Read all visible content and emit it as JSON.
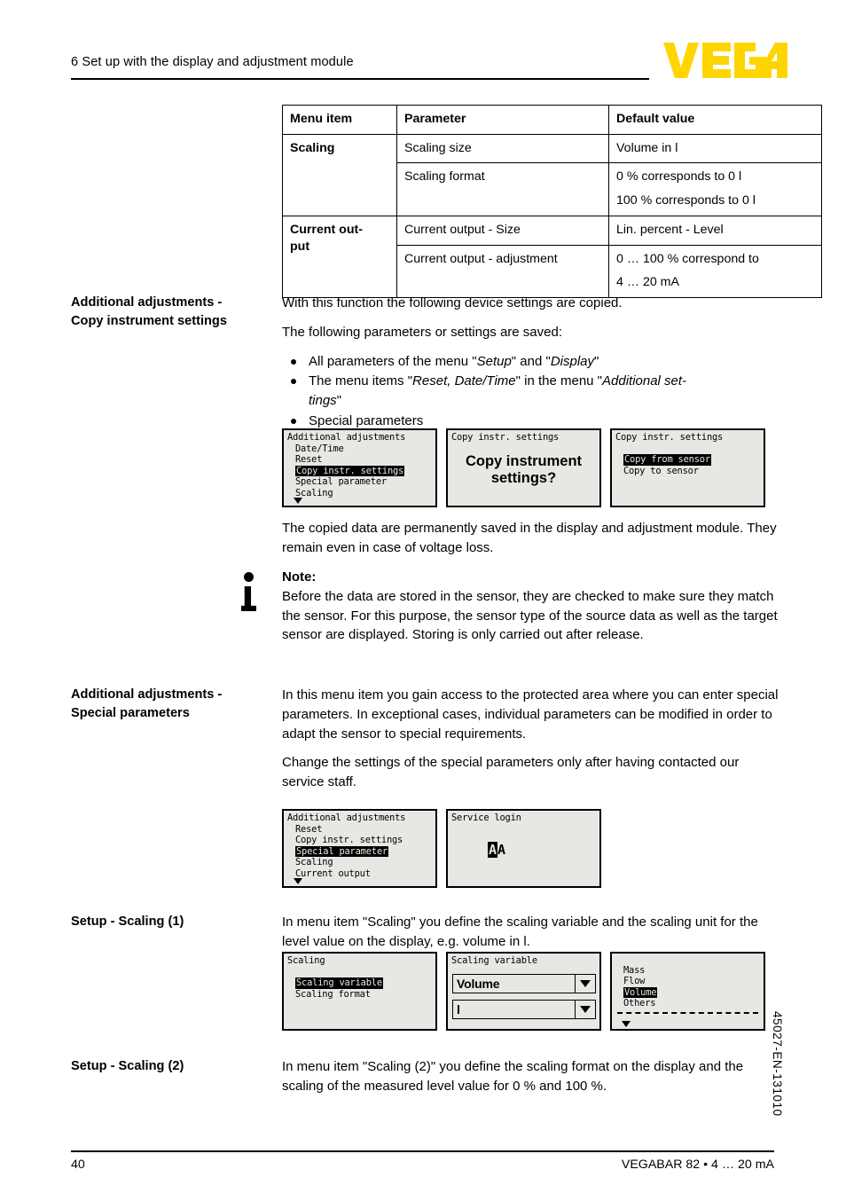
{
  "header": {
    "chapter_title": "6 Set up with the display and adjustment module",
    "logo_text": "VEGA",
    "logo_color": "#FFD500"
  },
  "table": {
    "columns": [
      "Menu item",
      "Parameter",
      "Default value"
    ],
    "rows": [
      {
        "menu_item": "Scaling",
        "parameter": "Scaling size",
        "default_value": [
          "Volume in l"
        ]
      },
      {
        "menu_item": "",
        "parameter": "Scaling format",
        "default_value": [
          "0 % corresponds to 0 l",
          "100 % corresponds to 0 l"
        ]
      },
      {
        "menu_item": "Current out-\nput",
        "parameter": "Current output - Size",
        "default_value": [
          "Lin. percent - Level"
        ]
      },
      {
        "menu_item": "",
        "parameter": "Current output - adjustment",
        "default_value": [
          "0 … 100 % correspond to",
          "4 … 20 mA"
        ]
      }
    ]
  },
  "sections": [
    {
      "marginal": "Additional adjustments -\nCopy instrument settings",
      "paragraphs": [
        "With this function the following device settings are copied.",
        "The following parameters or settings are saved:"
      ],
      "bullets": [
        "All parameters of the menu \"Setup\" and \"Display\"",
        "The menu items \"Reset, Date/Time\" in the menu \"Additional settings\"",
        "Special parameters"
      ],
      "after_figure_paragraph": "The copied data are permanently saved in the display and adjustment module. They remain even in case of voltage loss."
    },
    {
      "marginal": "Additional adjustments -\nSpecial parameters",
      "paragraphs": [
        "In this menu item you gain access to the protected area where you can enter special parameters. In exceptional cases, individual parameters can be modified in order to adapt the sensor to special requirements.",
        "Change the settings of the special parameters only after having contacted our service staff."
      ]
    },
    {
      "marginal": "Setup - Scaling (1)",
      "paragraphs": [
        "In menu item \"Scaling\" you define the scaling variable and the scaling unit for the level value on the display, e.g. volume in l."
      ]
    },
    {
      "marginal": "Setup - Scaling (2)",
      "paragraphs": [
        "In menu item \"Scaling (2)\" you define the scaling format on the display and the scaling of the measured level value for 0 % and 100 %."
      ]
    }
  ],
  "note": {
    "heading": "Note:",
    "text": "Before the data are stored in the sensor, they are checked to make sure they match the sensor. For this purpose, the sensor type of the source data as well as the target sensor are displayed. Storing is only carried out after release."
  },
  "figures": {
    "copy_settings": [
      {
        "title": "Additional adjustments",
        "items": [
          {
            "label": "Date/Time",
            "selected": false
          },
          {
            "label": "Reset",
            "selected": false
          },
          {
            "label": "Copy instr. settings",
            "selected": true
          },
          {
            "label": "Special parameter",
            "selected": false
          },
          {
            "label": "Scaling",
            "selected": false
          }
        ],
        "more_arrow": true
      },
      {
        "title": "Copy instr. settings",
        "prompt_line1": "Copy instrument",
        "prompt_line2": "settings?"
      },
      {
        "title": "Copy instr. settings",
        "items": [
          {
            "label": "Copy from sensor",
            "selected": true
          },
          {
            "label": "Copy to sensor",
            "selected": false
          }
        ],
        "more_arrow": false
      }
    ],
    "special_parameters": [
      {
        "title": "Additional adjustments",
        "items": [
          {
            "label": "Reset",
            "selected": false
          },
          {
            "label": "Copy instr. settings",
            "selected": false
          },
          {
            "label": "Special parameter",
            "selected": true
          },
          {
            "label": "Scaling",
            "selected": false
          },
          {
            "label": "Current output",
            "selected": false
          }
        ],
        "more_arrow": true
      },
      {
        "title": "Service login",
        "glyph_inverted": "A",
        "glyph_plain": "A"
      }
    ],
    "scaling": [
      {
        "title": "Scaling",
        "items": [
          {
            "label": "Scaling variable",
            "selected": true
          },
          {
            "label": "Scaling format",
            "selected": false
          }
        ],
        "more_arrow": false
      },
      {
        "title": "Scaling variable",
        "dropdown_1": "Volume",
        "dropdown_2": "l"
      },
      {
        "title": "",
        "items": [
          {
            "label": "Mass",
            "selected": false
          },
          {
            "label": "Flow",
            "selected": false
          },
          {
            "label": "Volume",
            "selected": true
          },
          {
            "label": "Others",
            "selected": false
          }
        ],
        "more_arrow": true,
        "divider": true
      }
    ]
  },
  "footer": {
    "page_number": "40",
    "product": "VEGABAR 82 • 4 … 20 mA",
    "doc_code": "45027-EN-131010"
  }
}
